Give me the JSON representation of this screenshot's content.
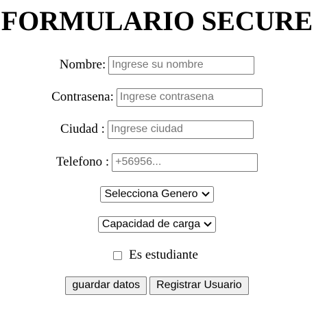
{
  "form": {
    "title": "FORMULARIO SECURE",
    "nombre": {
      "label": "Nombre:",
      "placeholder": "Ingrese su nombre",
      "value": ""
    },
    "contrasena": {
      "label": "Contrasena:",
      "placeholder": "Ingrese contrasena",
      "value": ""
    },
    "ciudad": {
      "label": "Ciudad :",
      "placeholder": "Ingrese ciudad",
      "value": ""
    },
    "telefono": {
      "label": "Telefono :",
      "placeholder": "+56956...",
      "value": ""
    },
    "genero_select": {
      "selected": "Selecciona Genero",
      "icon": "chevron-down-icon"
    },
    "carga_select": {
      "selected": "Capacidad de carga",
      "icon": "chevron-down-icon"
    },
    "estudiante": {
      "label": "Es estudiante",
      "checked": false
    },
    "buttons": {
      "guardar": "guardar datos",
      "registrar": "Registrar Usuario"
    }
  }
}
